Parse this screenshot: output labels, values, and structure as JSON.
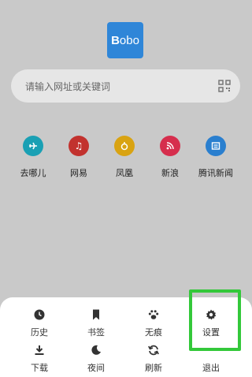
{
  "logo": {
    "text_first": "B",
    "text_rest": "obo",
    "color": "#2f86d8"
  },
  "search": {
    "placeholder": "请输入网址或关键词",
    "icon": "qr-scan-icon"
  },
  "shortcuts": [
    {
      "label": "去哪儿",
      "color": "#1aa0b4",
      "icon": "airplane-icon"
    },
    {
      "label": "网易",
      "color": "#c2322e",
      "icon": "music-note-icon"
    },
    {
      "label": "凤凰",
      "color": "#d9a312",
      "icon": "phoenix-icon"
    },
    {
      "label": "新浪",
      "color": "#d62e4d",
      "icon": "rss-icon"
    },
    {
      "label": "腾讯新闻",
      "color": "#2a7fcf",
      "icon": "news-icon"
    }
  ],
  "menu": {
    "history": {
      "label": "历史",
      "icon": "clock-icon"
    },
    "bookmarks": {
      "label": "书签",
      "icon": "bookmark-icon"
    },
    "incognito": {
      "label": "无痕",
      "icon": "paw-icon"
    },
    "settings": {
      "label": "设置",
      "icon": "gear-icon"
    },
    "download": {
      "label": "下载",
      "icon": "download-icon"
    },
    "night": {
      "label": "夜间",
      "icon": "moon-icon"
    },
    "refresh": {
      "label": "刷新",
      "icon": "refresh-icon"
    },
    "exit": {
      "label": "退出"
    }
  },
  "highlight_color": "#33c83a"
}
